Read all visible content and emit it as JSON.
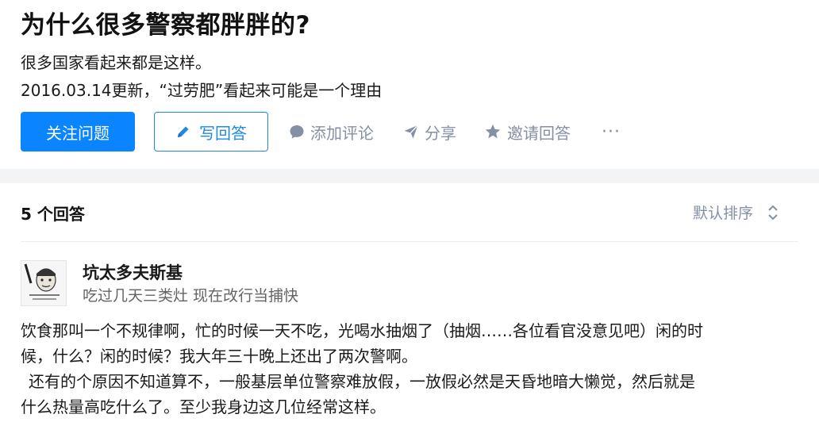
{
  "question": {
    "title": "为什么很多警察都胖胖的?",
    "desc_line1": "很多国家看起来都是这样。",
    "desc_line2": "2016.03.14更新，“过劳肥”看起来可能是一个理由"
  },
  "actions": {
    "follow": "关注问题",
    "write": "写回答",
    "comment": "添加评论",
    "share": "分享",
    "invite": "邀请回答",
    "more": "···"
  },
  "answers": {
    "count_label": "5 个回答",
    "sort_label": "默认排序"
  },
  "answer": {
    "author": "坑太多夫斯基",
    "bio": "吃过几天三类灶 现在改行当捕快",
    "para1_line1": "饮食那叫一个不规律啊，忙的时候一天不吃，光喝水抽烟了（抽烟……各位看官没意见吧）闲的时",
    "para1_line2": "候，什么？闲的时候？我大年三十晚上还出了两次警啊。",
    "para2_line1": "还有的个原因不知道算不，一般基层单位警察难放假，一放假必然是天昏地暗大懒觉，然后就是",
    "para2_line2": "什么热量高吃什么了。至少我身边这几位经常这样。"
  },
  "colors": {
    "primary": "#0a84ff",
    "outline": "#1e88e5",
    "muted": "#8590a6",
    "background": "#f3f4f6"
  },
  "icons": {
    "write": "pencil-icon",
    "comment": "comment-bubble-icon",
    "share": "paper-plane-icon",
    "invite": "star-icon",
    "sort": "sort-arrows-icon"
  }
}
